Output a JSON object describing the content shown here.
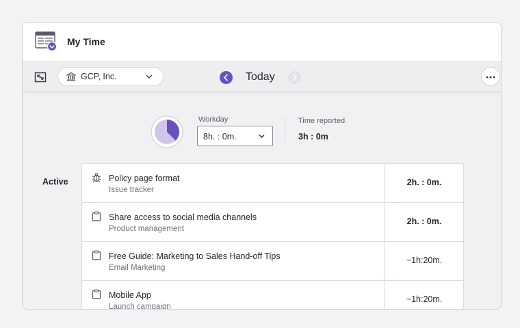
{
  "app": {
    "title": "My Time"
  },
  "toolbar": {
    "company": "GCP, Inc.",
    "date_label": "Today"
  },
  "summary": {
    "workday_label": "Workday",
    "workday_value": "8h. : 0m.",
    "reported_label": "Time reported",
    "reported_value": "3h : 0m",
    "reported_fraction": 0.375
  },
  "tasks": {
    "section_label": "Active",
    "items": [
      {
        "title": "Policy page format",
        "subtitle": "Issue tracker",
        "time": "2h. : 0m.",
        "icon": "bug-icon",
        "bold": true
      },
      {
        "title": "Share access to social media channels",
        "subtitle": "Product management",
        "time": "2h. : 0m.",
        "icon": "clipboard-icon",
        "bold": true
      },
      {
        "title": "Free Guide: Marketing to Sales Hand-off Tips",
        "subtitle": "Email Marketing",
        "time": "~1h:20m.",
        "icon": "clipboard-icon",
        "bold": false
      },
      {
        "title": "Mobile App",
        "subtitle": "Launch campaign",
        "time": "~1h:20m.",
        "icon": "clipboard-icon",
        "bold": false
      }
    ]
  },
  "colors": {
    "accent": "#6a4fc2",
    "pie_reported": "#6a4fc2",
    "pie_remaining": "#cfc6ec"
  }
}
